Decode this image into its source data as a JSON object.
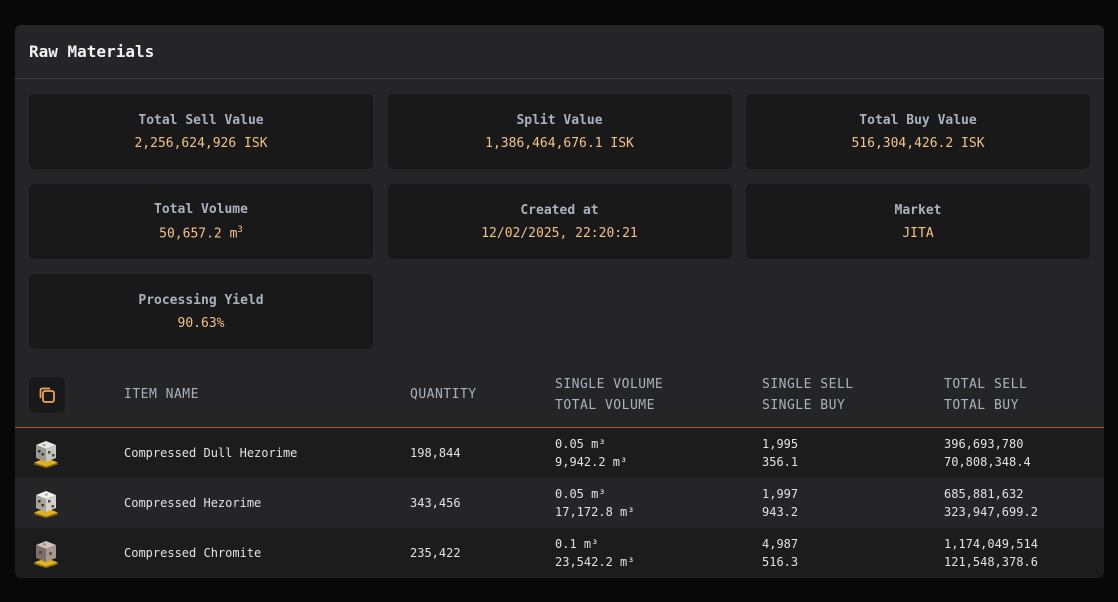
{
  "panel": {
    "title": "Raw Materials"
  },
  "stats": [
    {
      "label": "Total Sell Value",
      "value": "2,256,624,926 ISK"
    },
    {
      "label": "Split Value",
      "value": "1,386,464,676.1 ISK"
    },
    {
      "label": "Total Buy Value",
      "value": "516,304,426.2 ISK"
    },
    {
      "label": "Total Volume",
      "value": "50,657.2 m",
      "sup": "3"
    },
    {
      "label": "Created at",
      "value": "12/02/2025, 22:20:21"
    },
    {
      "label": "Market",
      "value": "JITA"
    },
    {
      "label": "Processing Yield",
      "value": "90.63%"
    }
  ],
  "table": {
    "headers": {
      "item_name": "ITEM NAME",
      "quantity": "QUANTITY",
      "single_volume": "SINGLE VOLUME",
      "total_volume": "TOTAL VOLUME",
      "single_sell": "SINGLE SELL",
      "single_buy": "SINGLE BUY",
      "total_sell": "TOTAL SELL",
      "total_buy": "TOTAL BUY"
    },
    "rows": [
      {
        "icon": "dull-hezorime-ore-icon",
        "name": "Compressed Dull Hezorime",
        "quantity": "198,844",
        "single_volume": "0.05 m³",
        "total_volume": "9,942.2 m³",
        "single_sell": "1,995",
        "single_buy": "356.1",
        "total_sell": "396,693,780",
        "total_buy": "70,808,348.4"
      },
      {
        "icon": "hezorime-ore-icon",
        "name": "Compressed Hezorime",
        "quantity": "343,456",
        "single_volume": "0.05 m³",
        "total_volume": "17,172.8 m³",
        "single_sell": "1,997",
        "single_buy": "943.2",
        "total_sell": "685,881,632",
        "total_buy": "323,947,699.2"
      },
      {
        "icon": "chromite-ore-icon",
        "name": "Compressed Chromite",
        "quantity": "235,422",
        "single_volume": "0.1 m³",
        "total_volume": "23,542.2 m³",
        "single_sell": "4,987",
        "single_buy": "516.3",
        "total_sell": "1,174,049,514",
        "total_buy": "121,548,378.6"
      }
    ]
  },
  "colors": {
    "accent_value": "#f2c28a",
    "header_divider": "#b8522c",
    "copy_icon": "#f2a65c"
  }
}
